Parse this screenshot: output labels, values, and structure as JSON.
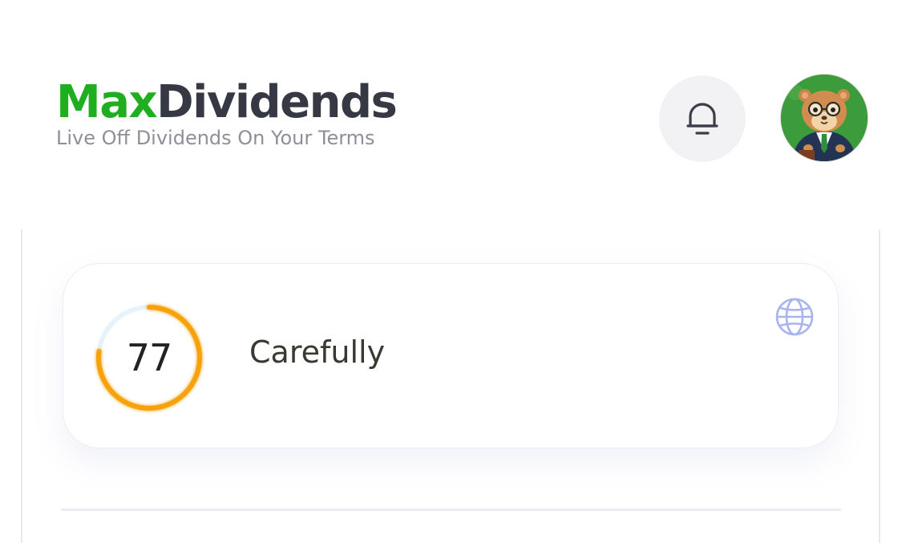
{
  "header": {
    "brand_part1": "Max",
    "brand_part2": "Dividends",
    "tagline": "Live Off Dividends On Your Terms",
    "notification_icon": "bell-icon",
    "avatar_icon": "hamster-avatar"
  },
  "card": {
    "score": "77",
    "score_fraction": 0.77,
    "label": "Carefully",
    "action_icon": "globe-icon"
  },
  "colors": {
    "brand_green": "#1fae1f",
    "brand_dark": "#363844",
    "gauge_orange": "#f5a20d",
    "gauge_track": "#e6f3fb",
    "globe_icon": "#a8b4ef"
  }
}
